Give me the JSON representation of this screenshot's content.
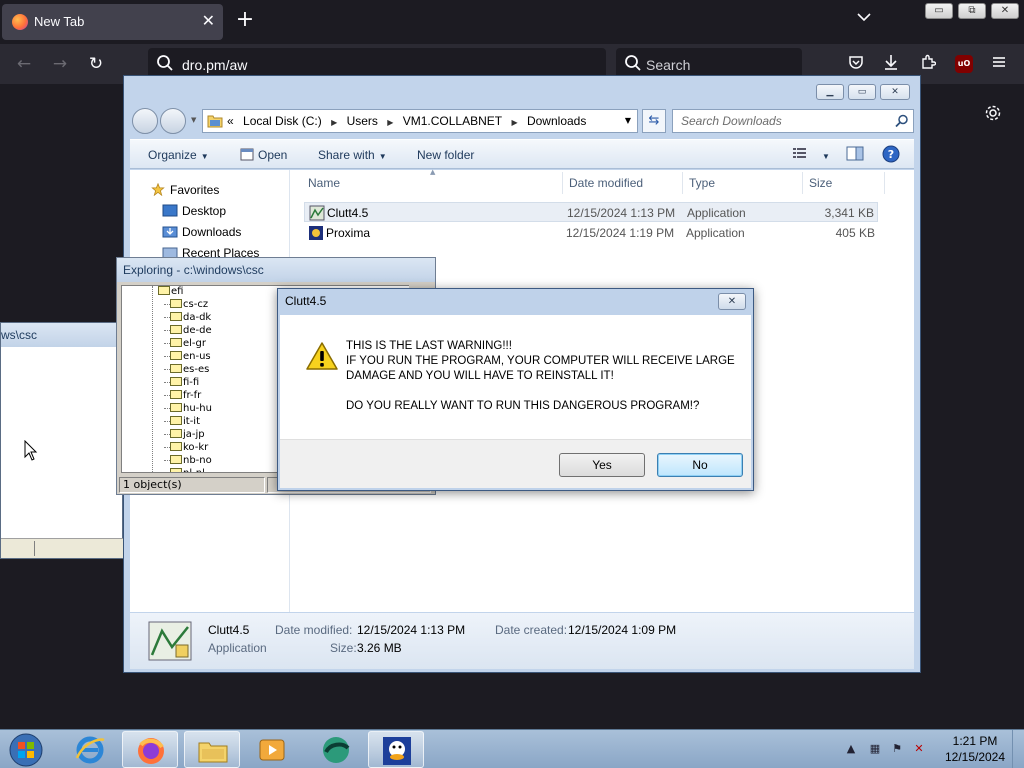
{
  "browser": {
    "tab_title": "New Tab",
    "tab_close": "✕",
    "new_tab": "+",
    "url": "dro.pm/aw",
    "search_placeholder": "Search",
    "ublock_label": "uO"
  },
  "vm_window": {
    "minimize": "▭",
    "restore": "⧉",
    "close": "✕"
  },
  "explorer": {
    "address": {
      "overflow": "«",
      "crumbs": [
        "Local Disk (C:)",
        "Users",
        "VM1.COLLABNET",
        "Downloads"
      ]
    },
    "search_placeholder": "Search Downloads",
    "commands": {
      "organize": "Organize",
      "open": "Open",
      "share_with": "Share with",
      "new_folder": "New folder"
    },
    "nav_pane": {
      "favorites": "Favorites",
      "items": [
        "Desktop",
        "Downloads",
        "Recent Places"
      ]
    },
    "columns": {
      "name": "Name",
      "date_modified": "Date modified",
      "type": "Type",
      "size": "Size"
    },
    "files": [
      {
        "name": "Clutt4.5",
        "date": "12/15/2024 1:13 PM",
        "type": "Application",
        "size": "3,341 KB"
      },
      {
        "name": "Proxima",
        "date": "12/15/2024 1:19 PM",
        "type": "Application",
        "size": "405 KB"
      }
    ],
    "details": {
      "name": "Clutt4.5",
      "kind": "Application",
      "date_modified_label": "Date modified:",
      "date_modified": "12/15/2024 1:13 PM",
      "size_label": "Size:",
      "size": "3.26 MB",
      "date_created_label": "Date created:",
      "date_created": "12/15/2024 1:09 PM"
    }
  },
  "left_window": {
    "title": "ws\\csc"
  },
  "exploring_window": {
    "title": "Exploring - c:\\windows\\csc",
    "root": "efi",
    "folders": [
      "cs-cz",
      "da-dk",
      "de-de",
      "el-gr",
      "en-us",
      "es-es",
      "fi-fi",
      "fr-fr",
      "hu-hu",
      "it-it",
      "ja-jp",
      "ko-kr",
      "nb-no",
      "nl-nl"
    ],
    "status": "1 object(s)"
  },
  "dialog": {
    "title": "Clutt4.5",
    "close": "✕",
    "message_line1": "THIS IS THE LAST WARNING!!!",
    "message_line2": "IF YOU RUN THE PROGRAM, YOUR COMPUTER WILL RECEIVE LARGE",
    "message_line3": "DAMAGE AND YOU WILL HAVE TO REINSTALL IT!",
    "message_line4": "DO YOU REALLY WANT TO RUN THIS DANGEROUS PROGRAM!?",
    "yes": "Yes",
    "no": "No"
  },
  "taskbar": {
    "time": "1:21 PM",
    "date": "12/15/2024",
    "tray_chevron": "▲"
  },
  "colors": {
    "firefox_bg": "#1c1b22",
    "explorer_frame": "#c2d4eb",
    "dialog_default_button": "#bee6fd",
    "taskbar": "#8aa6c6"
  }
}
